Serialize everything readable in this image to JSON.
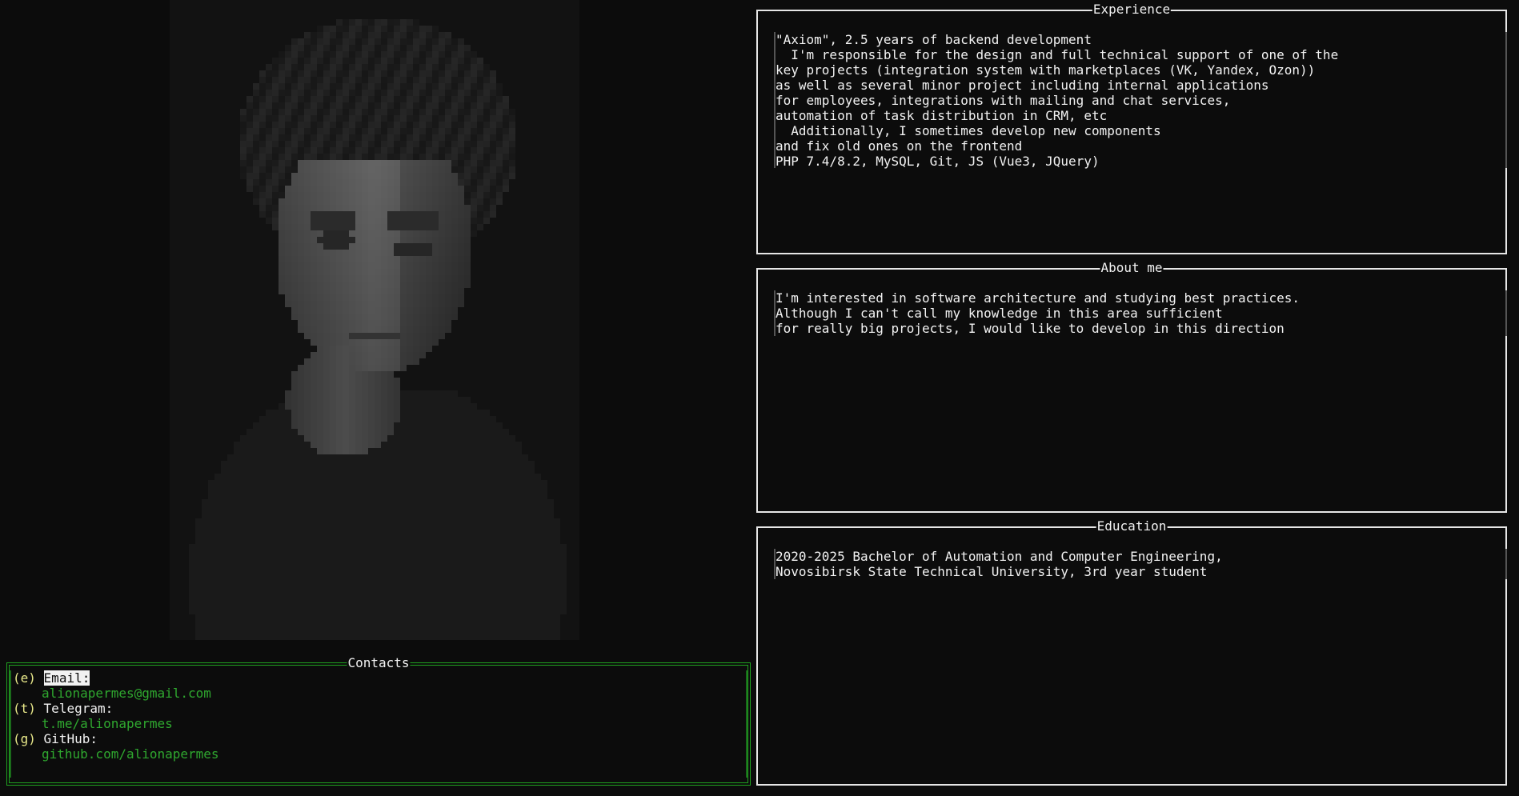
{
  "portrait": {
    "alt": "pixelated portrait photo"
  },
  "experience": {
    "title": "Experience",
    "lines": [
      "\"Axiom\", 2.5 years of backend development",
      "  I'm responsible for the design and full technical support of one of the",
      "key projects (integration system with marketplaces (VK, Yandex, Ozon))",
      "as well as several minor project including internal applications",
      "for employees, integrations with mailing and chat services,",
      "automation of task distribution in CRM, etc",
      "  Additionally, I sometimes develop new components",
      "and fix old ones on the frontend",
      "PHP 7.4/8.2, MySQL, Git, JS (Vue3, JQuery)"
    ]
  },
  "about": {
    "title": "About me",
    "lines": [
      "I'm interested in software architecture and studying best practices.",
      "Although I can't call my knowledge in this area sufficient",
      "for really big projects, I would like to develop in this direction"
    ]
  },
  "education": {
    "title": "Education",
    "lines": [
      "2020-2025 Bachelor of Automation and Computer Engineering,",
      "Novosibirsk State Technical University, 3rd year student"
    ]
  },
  "contacts": {
    "title": "Contacts",
    "items": [
      {
        "key": "(e)",
        "label": "Email:",
        "value": "alionapermes@gmail.com",
        "selected": true
      },
      {
        "key": "(t)",
        "label": "Telegram:",
        "value": "t.me/alionapermes",
        "selected": false
      },
      {
        "key": "(g)",
        "label": "GitHub:",
        "value": "github.com/alionapermes",
        "selected": false
      }
    ]
  },
  "colors": {
    "background": "#0c0c0c",
    "border": "#e6e6e6",
    "contacts_border": "#1fa11f",
    "link": "#2fa82f",
    "key": "#e9e98a"
  }
}
